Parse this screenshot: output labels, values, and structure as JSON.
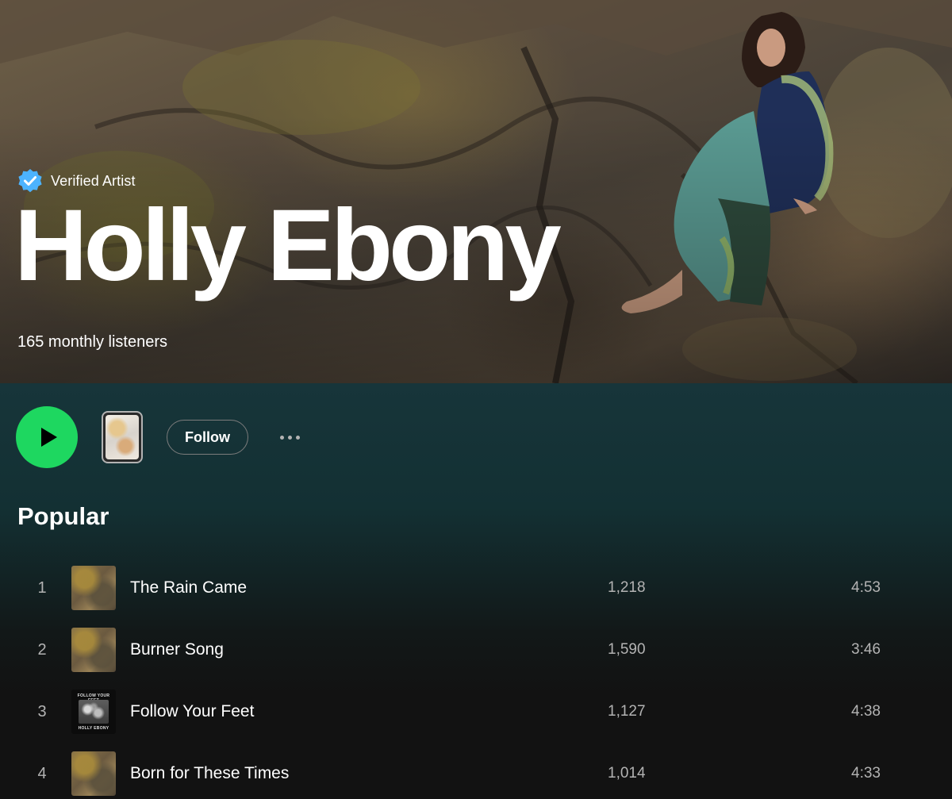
{
  "artist": {
    "verified_label": "Verified Artist",
    "name": "Holly Ebony",
    "monthly_listeners": "165 monthly listeners"
  },
  "actions": {
    "play_icon": "play-icon",
    "follow_label": "Follow",
    "more_icon": "more-horizontal-icon"
  },
  "popular": {
    "title": "Popular",
    "tracks": [
      {
        "number": "1",
        "title": "The Rain Came",
        "plays": "1,218",
        "duration": "4:53",
        "art": "rock-cover"
      },
      {
        "number": "2",
        "title": "Burner Song",
        "plays": "1,590",
        "duration": "3:46",
        "art": "rock-cover"
      },
      {
        "number": "3",
        "title": "Follow Your Feet",
        "plays": "1,127",
        "duration": "4:38",
        "art": "follow-your-feet-cover"
      },
      {
        "number": "4",
        "title": "Born for These Times",
        "plays": "1,014",
        "duration": "4:33",
        "art": "rock-cover"
      }
    ]
  },
  "cover_text": {
    "top": "FOLLOW YOUR FEET",
    "bottom": "HOLLY EBONY"
  },
  "colors": {
    "accent_green": "#1ed760",
    "verified_blue": "#4cb3ff",
    "background": "#121212",
    "header_teal": "#17353a"
  }
}
